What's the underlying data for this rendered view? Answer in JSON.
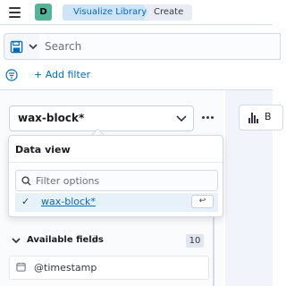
{
  "header": {
    "avatar_letter": "D",
    "breadcrumbs": [
      {
        "label": "Visualize Library"
      },
      {
        "label": "Create"
      }
    ]
  },
  "search": {
    "placeholder": "Search",
    "add_filter_label": "+ Add filter"
  },
  "data_view_picker": {
    "selected": "wax-block*"
  },
  "chart_type": {
    "label": "B"
  },
  "popover": {
    "title": "Data view",
    "filter_placeholder": "Filter options",
    "options": [
      {
        "label": "wax-block*",
        "selected": true
      }
    ],
    "enter_key_hint": "↩"
  },
  "fields": {
    "section_title": "Available fields",
    "info_icon": "ⓘ",
    "count": "10",
    "items": [
      {
        "name": "@timestamp",
        "type_icon": "calendar-icon"
      }
    ]
  },
  "colors": {
    "accent": "#006bb8",
    "breadcrumb_active_bg": "#d0e4f7",
    "avatar_bg": "#54b399"
  }
}
